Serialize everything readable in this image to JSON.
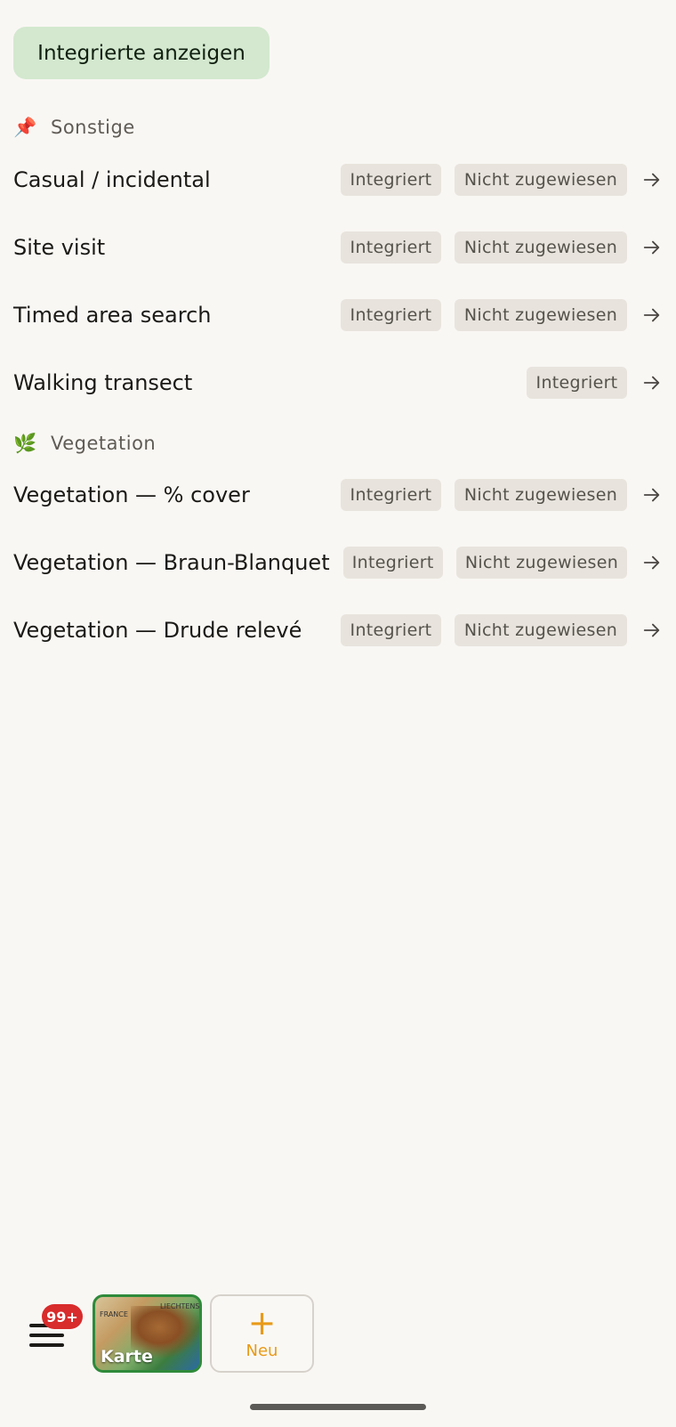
{
  "toggle_button": {
    "label": "Integrierte anzeigen"
  },
  "sections": [
    {
      "emoji": "📌",
      "title": "Sonstige",
      "items": [
        {
          "name": "Casual / incidental",
          "chips": [
            "Integriert",
            "Nicht zugewiesen"
          ]
        },
        {
          "name": "Site visit",
          "chips": [
            "Integriert",
            "Nicht zugewiesen"
          ]
        },
        {
          "name": "Timed area search",
          "chips": [
            "Integriert",
            "Nicht zugewiesen"
          ]
        },
        {
          "name": "Walking transect",
          "chips": [
            "Integriert"
          ]
        }
      ]
    },
    {
      "emoji": "🌿",
      "title": "Vegetation",
      "items": [
        {
          "name": "Vegetation — % cover",
          "chips": [
            "Integriert",
            "Nicht zugewiesen"
          ]
        },
        {
          "name": "Vegetation — Braun-Blanquet",
          "chips": [
            "Integriert",
            "Nicht zugewiesen"
          ]
        },
        {
          "name": "Vegetation — Drude relevé",
          "chips": [
            "Integriert",
            "Nicht zugewiesen"
          ]
        }
      ]
    }
  ],
  "bottom_bar": {
    "badge": "99+",
    "map_label": "Karte",
    "map_mini_labels": [
      "FRANCE",
      "LIECHTENS"
    ],
    "new_plus": "+",
    "new_label": "Neu"
  },
  "colors": {
    "background": "#f9f7f4",
    "toggle_bg": "#d3e8cf",
    "chip_bg": "#e8e4dd",
    "badge_bg": "#d82b2b",
    "accent": "#e89a18",
    "map_border": "#2f8a3a"
  }
}
